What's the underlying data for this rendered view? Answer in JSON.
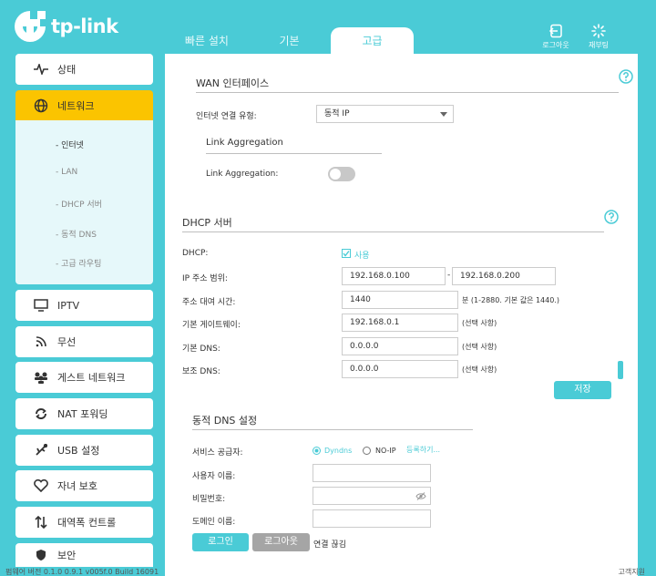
{
  "brand": {
    "logo_text": "tp-link",
    "accent": "#4acbd6",
    "active_menu_color": "#fbc400"
  },
  "tabs": [
    {
      "label": "빠른 설치"
    },
    {
      "label": "기본"
    },
    {
      "label": "고급",
      "active": true
    }
  ],
  "header_buttons": {
    "logout": "로그아웃",
    "reboot": "재부팅"
  },
  "sidebar": {
    "items": [
      {
        "label": "상태",
        "icon": "pulse-icon"
      },
      {
        "label": "네트워크",
        "icon": "globe-icon",
        "active": true
      },
      {
        "label": "IPTV",
        "icon": "monitor-icon"
      },
      {
        "label": "무선",
        "icon": "wifi-icon"
      },
      {
        "label": "게스트 네트워크",
        "icon": "guest-users-icon"
      },
      {
        "label": "NAT 포워딩",
        "icon": "nat-forwarding-icon"
      },
      {
        "label": "USB 설정",
        "icon": "usb-icon"
      },
      {
        "label": "자녀 보호",
        "icon": "heart-icon"
      },
      {
        "label": "대역폭 컨트롤",
        "icon": "bandwidth-arrows-icon"
      },
      {
        "label": "보안",
        "icon": "shield-icon"
      }
    ],
    "submenu": [
      {
        "label": "- 인터넷",
        "active": true
      },
      {
        "label": "- LAN"
      },
      {
        "label": "- DHCP 서버"
      },
      {
        "label": "- 동적 DNS"
      },
      {
        "label": "- 고급 라우팅"
      }
    ]
  },
  "wan": {
    "title": "WAN 인터페이스",
    "conn_type_label": "인터넷 연결 유형:",
    "conn_type_value": "동적 IP",
    "link_agg_title": "Link Aggregation",
    "link_agg_label": "Link Aggregation:",
    "link_agg_enabled": false
  },
  "dhcp": {
    "title": "DHCP 서버",
    "dhcp_label": "DHCP:",
    "dhcp_checkbox_label": "사용",
    "dhcp_enabled": true,
    "ip_range_label": "IP 주소 범위:",
    "ip_start": "192.168.0.100",
    "ip_range_sep": "-",
    "ip_end": "192.168.0.200",
    "lease_label": "주소 대여 시간:",
    "lease_value": "1440",
    "lease_hint": "분 (1-2880. 기본 값은 1440.)",
    "gateway_label": "기본 게이트웨이:",
    "gateway_value": "192.168.0.1",
    "gateway_hint": "(선택 사항)",
    "dns1_label": "기본 DNS:",
    "dns1_value": "0.0.0.0",
    "dns1_hint": "(선택 사항)",
    "dns2_label": "보조 DNS:",
    "dns2_value": "0.0.0.0",
    "dns2_hint": "(선택 사항)",
    "save_label": "저장"
  },
  "ddns": {
    "title": "동적 DNS 설정",
    "provider_label": "서비스 공급자:",
    "provider_options": [
      "Dyndns",
      "NO-IP"
    ],
    "provider_selected": "Dyndns",
    "register_link": "등록하기...",
    "username_label": "사용자 이름:",
    "username_value": "",
    "password_label": "비밀번호:",
    "password_value": "",
    "domain_label": "도메인 이름:",
    "domain_value": "",
    "login_label": "로그인",
    "logout_label": "로그아웃",
    "status_text": "연결 끊김"
  },
  "footer": {
    "firmware": "펌웨어 버전 0.1.0 0.9.1 v005f.0 Build 16091",
    "support": "고객지원"
  }
}
